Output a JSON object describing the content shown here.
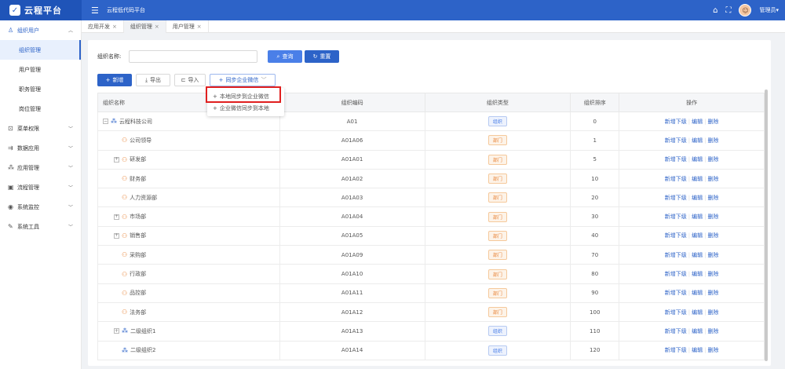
{
  "header": {
    "brand": "云程平台",
    "platform_title": "云程低代码平台",
    "user_name": "管理员▾"
  },
  "sidebar": {
    "groups": [
      {
        "icon": "users-icon",
        "label": "组织用户",
        "open": true,
        "items": [
          {
            "label": "组织管理",
            "active": true
          },
          {
            "label": "用户管理",
            "active": false
          },
          {
            "label": "职务管理",
            "active": false
          },
          {
            "label": "岗位管理",
            "active": false
          }
        ]
      },
      {
        "icon": "lock-icon",
        "label": "菜单权限"
      },
      {
        "icon": "data-icon",
        "label": "数据应用"
      },
      {
        "icon": "apps-icon",
        "label": "应用管理"
      },
      {
        "icon": "flow-icon",
        "label": "流程管理"
      },
      {
        "icon": "monitor-icon",
        "label": "系统监控"
      },
      {
        "icon": "tools-icon",
        "label": "系统工具"
      }
    ]
  },
  "tabs": [
    {
      "label": "应用开发",
      "active": false
    },
    {
      "label": "组织管理",
      "active": true
    },
    {
      "label": "用户管理",
      "active": false
    }
  ],
  "search": {
    "label": "组织名称:",
    "value": "",
    "query_label": "查询",
    "reset_label": "重置"
  },
  "toolbar": {
    "new_label": "新增",
    "export_label": "导出",
    "import_label": "导入",
    "sync_label": "同步企业微信"
  },
  "sync_menu": {
    "items": [
      "本地同步到企业微信",
      "企业微信同步到本地"
    ],
    "highlighted_index": 0
  },
  "table": {
    "headers": [
      "组织名称",
      "组织编码",
      "组织类型",
      "组织排序",
      "操作"
    ],
    "ops": [
      "新增下级",
      "编辑",
      "删除"
    ],
    "rows": [
      {
        "name": "云程科技公司",
        "code": "A01",
        "type": "组织",
        "kind": "org",
        "sort": "0",
        "level": 0,
        "expander": "−"
      },
      {
        "name": "公司领导",
        "code": "A01A06",
        "type": "部门",
        "kind": "dept",
        "sort": "1",
        "level": 1,
        "expander": ""
      },
      {
        "name": "研发部",
        "code": "A01A01",
        "type": "部门",
        "kind": "dept",
        "sort": "5",
        "level": 1,
        "expander": "+"
      },
      {
        "name": "财务部",
        "code": "A01A02",
        "type": "部门",
        "kind": "dept",
        "sort": "10",
        "level": 1,
        "expander": ""
      },
      {
        "name": "人力资源部",
        "code": "A01A03",
        "type": "部门",
        "kind": "dept",
        "sort": "20",
        "level": 1,
        "expander": ""
      },
      {
        "name": "市场部",
        "code": "A01A04",
        "type": "部门",
        "kind": "dept",
        "sort": "30",
        "level": 1,
        "expander": "+"
      },
      {
        "name": "销售部",
        "code": "A01A05",
        "type": "部门",
        "kind": "dept",
        "sort": "40",
        "level": 1,
        "expander": "+"
      },
      {
        "name": "采购部",
        "code": "A01A09",
        "type": "部门",
        "kind": "dept",
        "sort": "70",
        "level": 1,
        "expander": ""
      },
      {
        "name": "行政部",
        "code": "A01A10",
        "type": "部门",
        "kind": "dept",
        "sort": "80",
        "level": 1,
        "expander": ""
      },
      {
        "name": "品控部",
        "code": "A01A11",
        "type": "部门",
        "kind": "dept",
        "sort": "90",
        "level": 1,
        "expander": ""
      },
      {
        "name": "法务部",
        "code": "A01A12",
        "type": "部门",
        "kind": "dept",
        "sort": "100",
        "level": 1,
        "expander": ""
      },
      {
        "name": "二级组织1",
        "code": "A01A13",
        "type": "组织",
        "kind": "org",
        "sort": "110",
        "level": 1,
        "expander": "+"
      },
      {
        "name": "二级组织2",
        "code": "A01A14",
        "type": "组织",
        "kind": "org",
        "sort": "120",
        "level": 1,
        "expander": ""
      }
    ]
  },
  "colors": {
    "primary": "#2d63c8",
    "dept_tag": "#e8853a",
    "highlight": "#e02020"
  }
}
